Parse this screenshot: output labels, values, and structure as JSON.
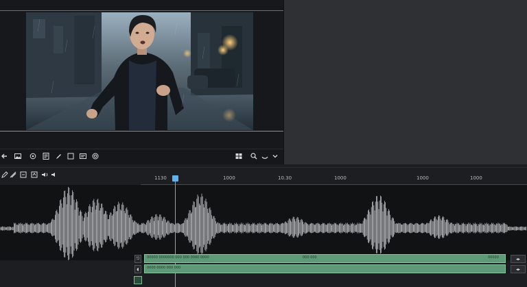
{
  "theme": {
    "background": "#1d1e21",
    "panel": "#2f3033",
    "accent": "#5db3ea",
    "clip_color": "#5f9a78"
  },
  "viewer": {
    "frame": {
      "image": "man-running-in-rain"
    },
    "toolbar_icons": [
      "back-arrow-icon",
      "image-icon",
      "circle-tool-icon",
      "note-icon",
      "brush-icon",
      "square-icon",
      "caption-icon",
      "target-icon"
    ],
    "toolbar_right_icons": [
      "grid-icon",
      "zoom-icon",
      "link-icon",
      "chevron-down-icon"
    ]
  },
  "timeline": {
    "toolbar_icons": [
      "pen-icon",
      "razor-icon",
      "clip-icon",
      "audio-icon",
      "speaker-icon"
    ],
    "ruler_labels": [
      "1130",
      "1000",
      "10.30",
      "1000",
      "1000",
      "1000"
    ],
    "tracks": {
      "clip_top_label": "00000 0000000 000 000 0000 0000",
      "clip_top_label2": "000 000",
      "clip_top_right": "00000",
      "clip_bottom_label": "0000 0000 000 000"
    }
  }
}
